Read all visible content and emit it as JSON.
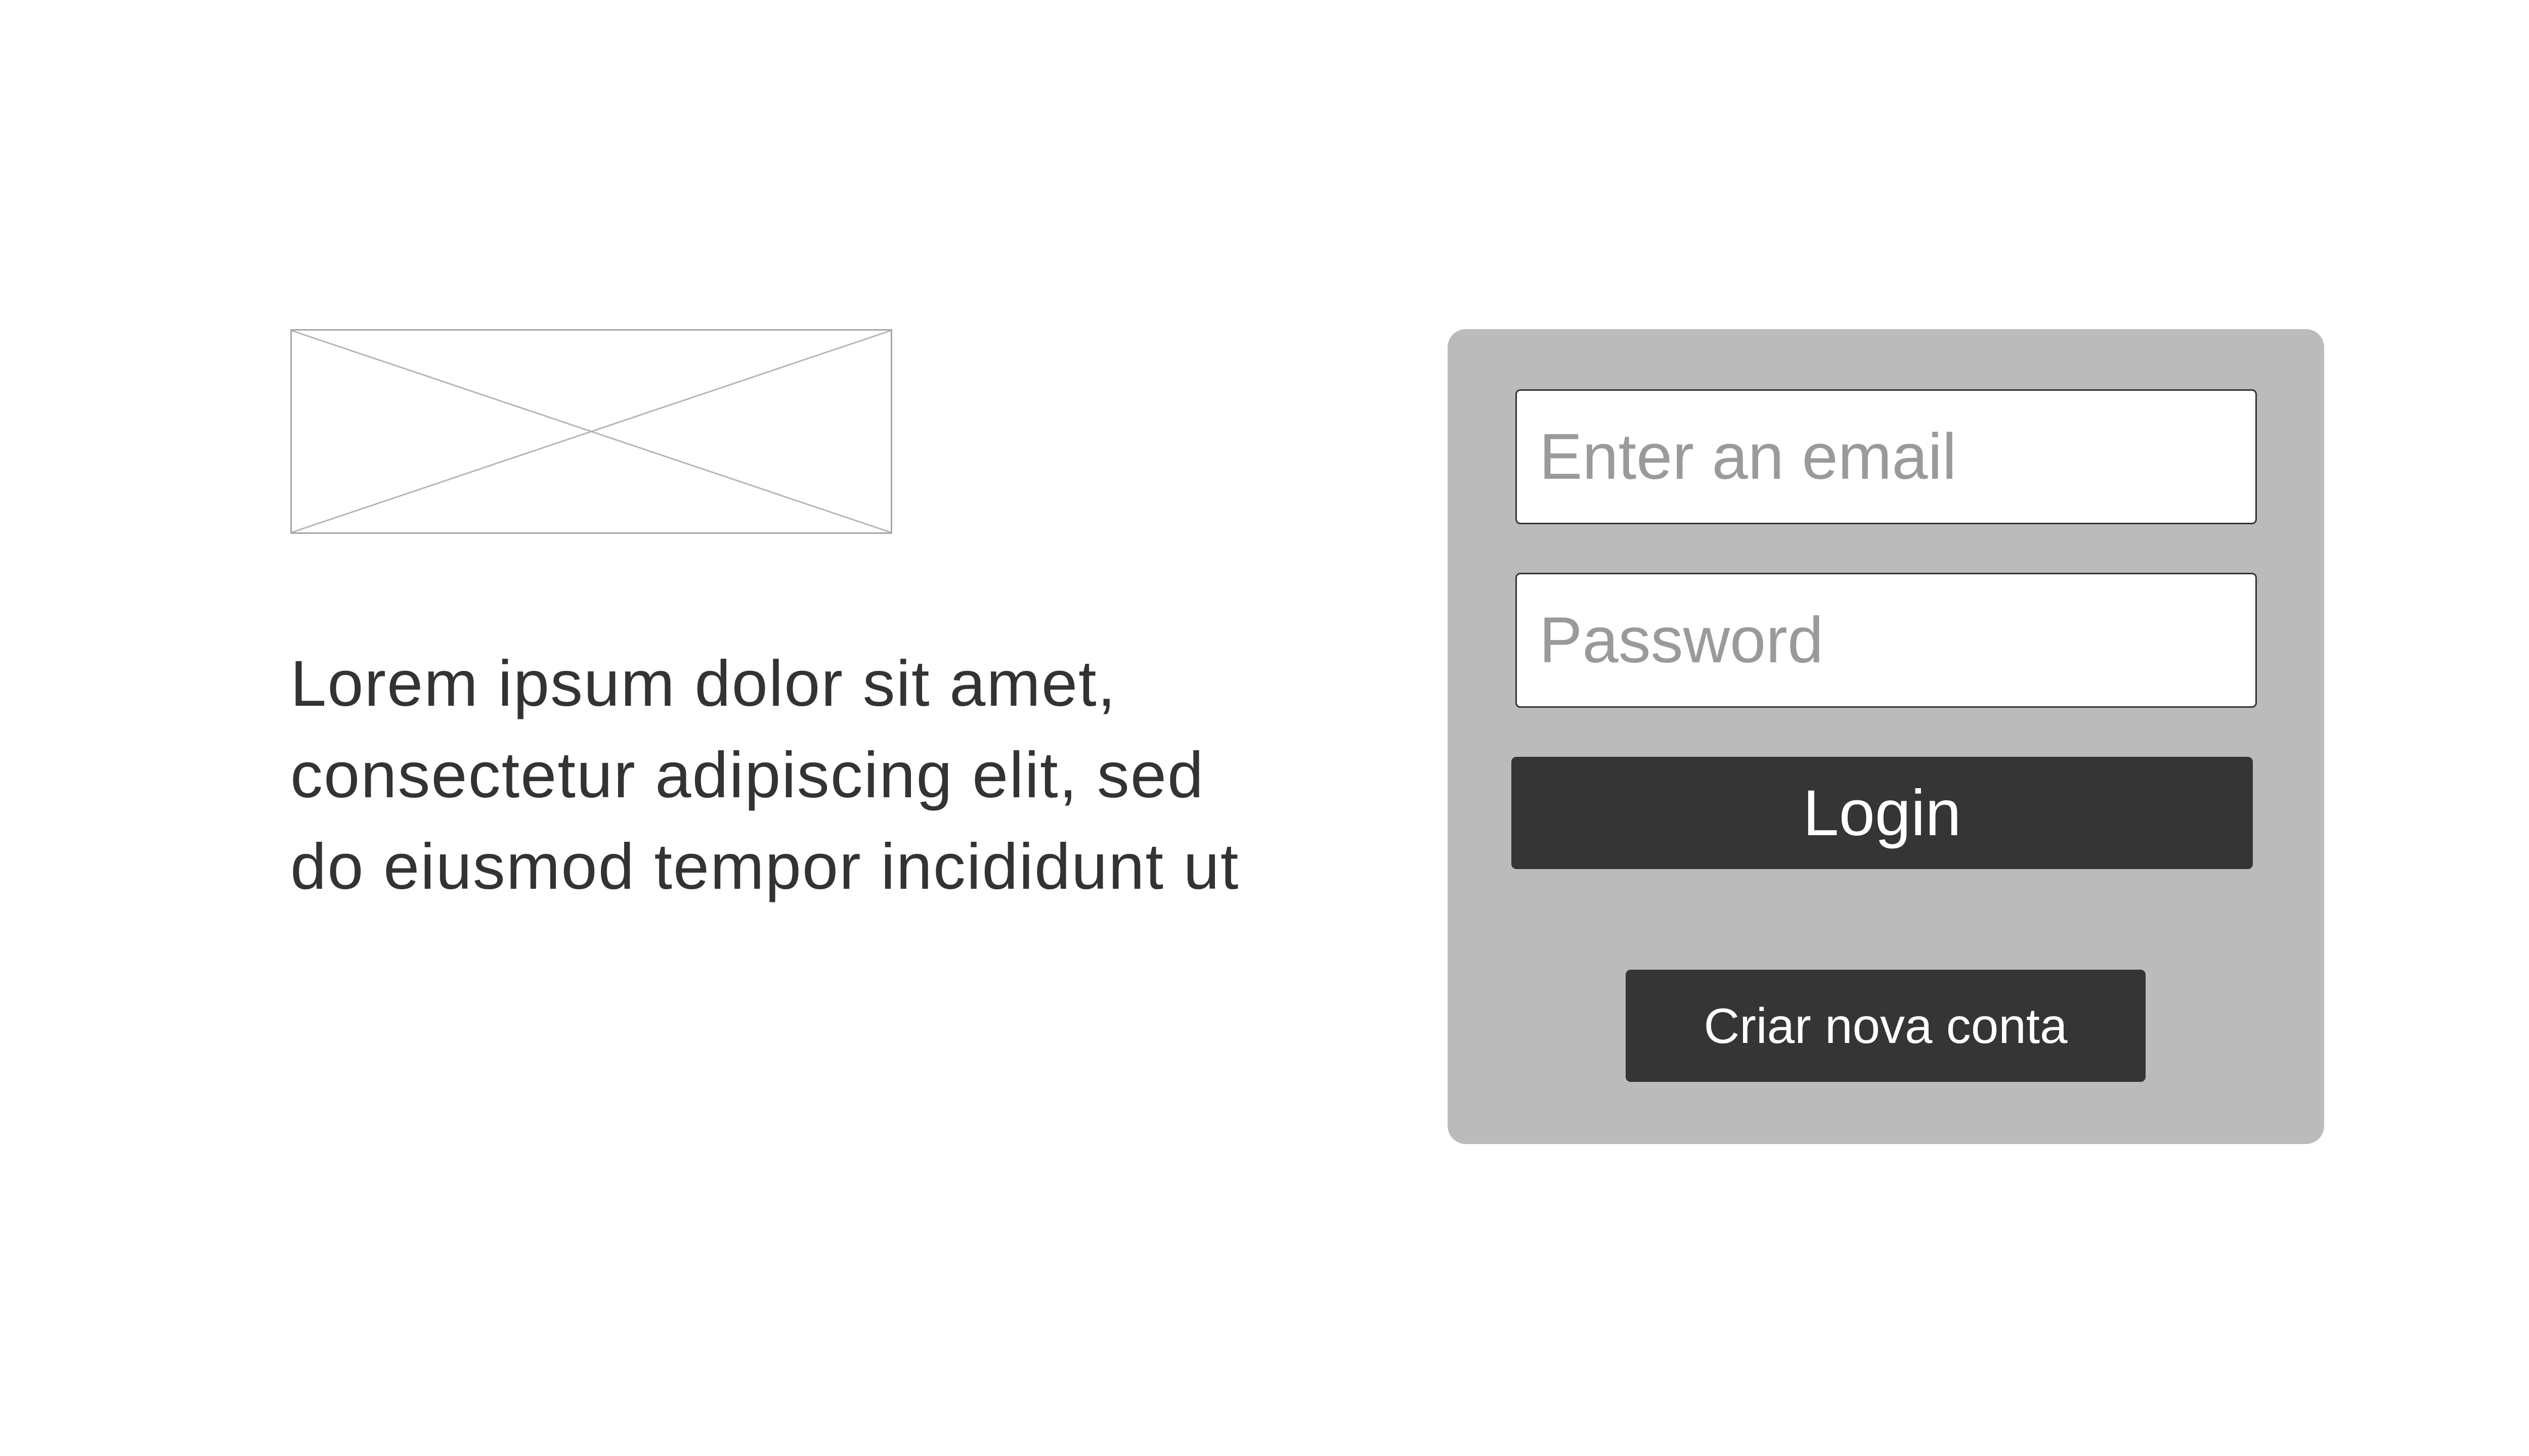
{
  "logo": {
    "icon": "image-placeholder-icon"
  },
  "intro": {
    "text": "Lorem ipsum dolor sit amet,\nconsectetur adipiscing elit, sed\ndo eiusmod tempor incididunt ut"
  },
  "login_form": {
    "email_placeholder": "Enter an email",
    "email_value": "",
    "password_placeholder": "Password",
    "password_value": "",
    "login_label": "Login",
    "create_account_label": "Criar nova conta"
  },
  "colors": {
    "panel_background": "#bbbbbb",
    "button_background": "#353535",
    "button_text": "#ffffff",
    "body_text": "#333333",
    "placeholder_text": "#9a9a9a"
  }
}
